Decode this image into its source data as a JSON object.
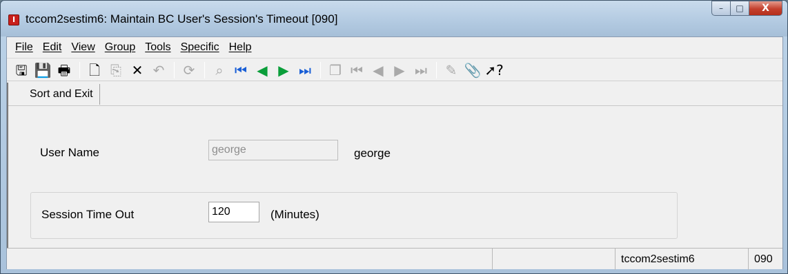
{
  "window": {
    "title": "tccom2sestim6: Maintain BC User's Session's Timeout [090]",
    "app_icon": "infor-ln-icon",
    "caption_buttons": {
      "minimize": "–",
      "maximize": "□",
      "close": "X"
    }
  },
  "menu": {
    "items": [
      {
        "label": "File"
      },
      {
        "label": "Edit"
      },
      {
        "label": "View"
      },
      {
        "label": "Group"
      },
      {
        "label": "Tools"
      },
      {
        "label": "Specific"
      },
      {
        "label": "Help"
      }
    ]
  },
  "toolbar": {
    "buttons": [
      {
        "icon": "save-and-exit-icon",
        "glyph": "🖫",
        "enabled": true
      },
      {
        "icon": "save-icon",
        "glyph": "💾",
        "enabled": true
      },
      {
        "icon": "print-icon",
        "glyph": "🖶",
        "enabled": true
      },
      {
        "sep": true
      },
      {
        "icon": "new-icon",
        "glyph": "🗋",
        "enabled": true
      },
      {
        "icon": "copy-icon",
        "glyph": "⎘",
        "enabled": false
      },
      {
        "icon": "delete-icon",
        "glyph": "✕",
        "enabled": true
      },
      {
        "icon": "undo-icon",
        "glyph": "↶",
        "enabled": false
      },
      {
        "sep": true
      },
      {
        "icon": "refresh-icon",
        "glyph": "⟳",
        "enabled": false
      },
      {
        "sep": true
      },
      {
        "icon": "find-icon",
        "glyph": "⌕",
        "enabled": false
      },
      {
        "icon": "first-record-icon",
        "glyph": "⏮",
        "enabled": true,
        "style": "nav"
      },
      {
        "icon": "previous-record-icon",
        "glyph": "◀",
        "enabled": true,
        "style": "nav2"
      },
      {
        "icon": "next-record-icon",
        "glyph": "▶",
        "enabled": true,
        "style": "nav2"
      },
      {
        "icon": "last-record-icon",
        "glyph": "⏭",
        "enabled": true,
        "style": "nav"
      },
      {
        "sep": true
      },
      {
        "icon": "group-copy-icon",
        "glyph": "❐",
        "enabled": false
      },
      {
        "icon": "group-first-icon",
        "glyph": "⏮",
        "enabled": false
      },
      {
        "icon": "group-previous-icon",
        "glyph": "◀",
        "enabled": false
      },
      {
        "icon": "group-next-icon",
        "glyph": "▶",
        "enabled": false
      },
      {
        "icon": "group-last-icon",
        "glyph": "⏭",
        "enabled": false
      },
      {
        "sep": true
      },
      {
        "icon": "text-icon",
        "glyph": "✎",
        "enabled": false
      },
      {
        "icon": "attachment-icon",
        "glyph": "📎",
        "enabled": false
      },
      {
        "icon": "help-pointer-icon",
        "glyph": "➚?",
        "enabled": true
      }
    ]
  },
  "sortbar": {
    "button_label": "Sort and Exit"
  },
  "form": {
    "user_name_label": "User Name",
    "user_name_value": "george",
    "user_name_description": "george",
    "session_timeout_label": "Session Time Out",
    "session_timeout_value": "120",
    "session_timeout_unit": "(Minutes)"
  },
  "status": {
    "session": "tccom2sestim6",
    "company": "090"
  }
}
